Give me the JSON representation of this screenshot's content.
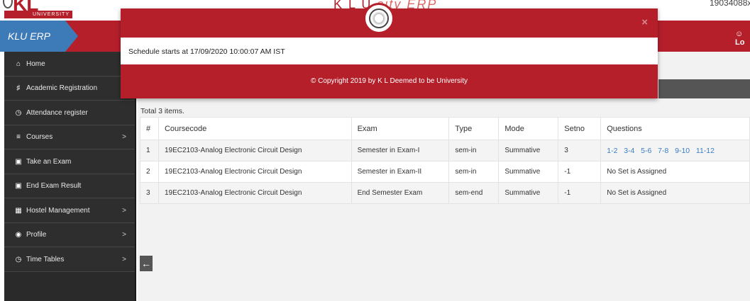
{
  "header": {
    "top_brand": "K L U",
    "top_brand_suffix": "sity ERP",
    "top_id": "19034088x",
    "logo_univ": "UNIVERSITY",
    "app_tag": "KLU ERP",
    "logout_label": "Lo"
  },
  "sidebar": {
    "items": [
      {
        "label": "Home",
        "icon": "home-icon",
        "has_chevron": false
      },
      {
        "label": "Academic Registration",
        "icon": "institution-icon",
        "has_chevron": false
      },
      {
        "label": "Attendance register",
        "icon": "clock-icon",
        "has_chevron": false
      },
      {
        "label": "Courses",
        "icon": "list-icon",
        "has_chevron": true
      },
      {
        "label": "Take an Exam",
        "icon": "lock-icon",
        "has_chevron": false
      },
      {
        "label": "End Exam Result",
        "icon": "lock-icon",
        "has_chevron": false
      },
      {
        "label": "Hostel Management",
        "icon": "building-icon",
        "has_chevron": true
      },
      {
        "label": "Profile",
        "icon": "user-icon",
        "has_chevron": true
      },
      {
        "label": "Time Tables",
        "icon": "clock-icon",
        "has_chevron": true
      }
    ]
  },
  "main": {
    "total_items": "Total 3 items.",
    "table": {
      "headers": [
        "#",
        "Coursecode",
        "Exam",
        "Type",
        "Mode",
        "Setno",
        "Questions"
      ],
      "rows": [
        {
          "num": "1",
          "coursecode": "19EC2103-Analog Electronic Circuit Design",
          "exam": "Semester in Exam-I",
          "type": "sem-in",
          "mode": "Summative",
          "setno": "3",
          "questions": [
            "1-2",
            "3-4",
            "5-6",
            "7-8",
            "9-10",
            "11-12"
          ],
          "questions_text": ""
        },
        {
          "num": "2",
          "coursecode": "19EC2103-Analog Electronic Circuit Design",
          "exam": "Semester in Exam-II",
          "type": "sem-in",
          "mode": "Summative",
          "setno": "-1",
          "questions": [],
          "questions_text": "No Set is Assigned"
        },
        {
          "num": "3",
          "coursecode": "19EC2103-Analog Electronic Circuit Design",
          "exam": "End Semester Exam",
          "type": "sem-end",
          "mode": "Summative",
          "setno": "-1",
          "questions": [],
          "questions_text": "No Set is Assigned"
        }
      ]
    }
  },
  "modal": {
    "close_symbol": "×",
    "message": "Schedule starts at 17/09/2020 10:00:07 AM IST",
    "footer": "© Copyright 2019 by K L Deemed to be University"
  },
  "colors": {
    "brand_red": "#b51f2a",
    "brand_blue": "#3d7ab8",
    "sidebar_bg": "#2e2e2e",
    "link_blue": "#3a7dc4"
  }
}
